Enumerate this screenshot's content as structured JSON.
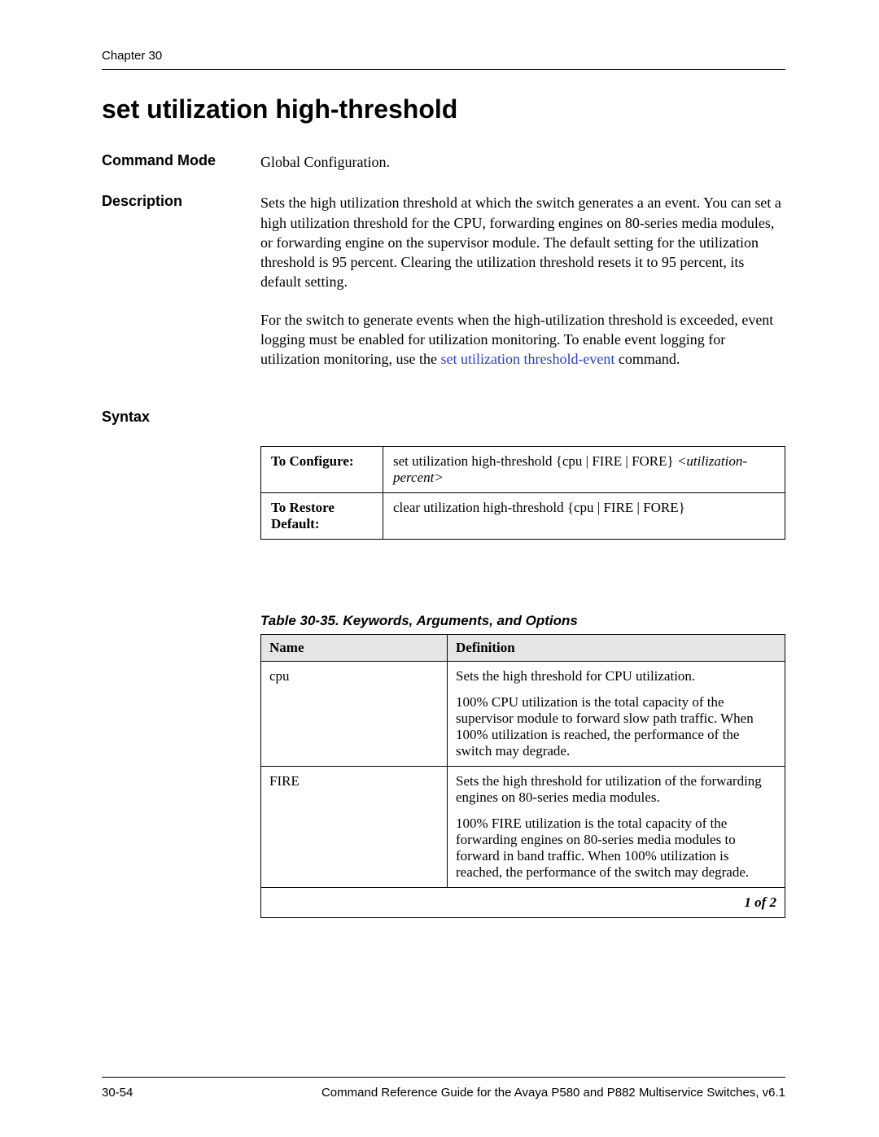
{
  "header": {
    "chapter": "Chapter 30"
  },
  "title": "set utilization high-threshold",
  "fields": {
    "command_mode": {
      "label": "Command Mode",
      "value": "Global Configuration."
    },
    "description": {
      "label": "Description",
      "para1": "Sets the high utilization threshold at which the switch generates a an event. You can set a high utilization threshold for the CPU, forwarding engines on 80-series media modules, or forwarding engine on the supervisor module. The default setting for the utilization threshold is 95 percent. Clearing the utilization threshold resets it to 95 percent, its default setting.",
      "para2_prefix": "For the switch to generate events when the high-utilization threshold is exceeded, event logging must be enabled for utilization monitoring. To enable event logging for utilization monitoring, use the ",
      "para2_link": "set utilization threshold-event",
      "para2_suffix": " command."
    },
    "syntax": {
      "label": "Syntax",
      "rows": [
        {
          "label": "To Configure:",
          "text_main": "set utilization high-threshold {cpu | FIRE | FORE} ",
          "text_italic": "<utilization-percent>"
        },
        {
          "label": "To Restore Default:",
          "text_main": "clear utilization high-threshold {cpu | FIRE | FORE}",
          "text_italic": ""
        }
      ]
    }
  },
  "keywords_table": {
    "caption": "Table 30-35. Keywords, Arguments, and Options",
    "headers": {
      "name": "Name",
      "definition": "Definition"
    },
    "rows": [
      {
        "name": "cpu",
        "def_p1": "Sets the high threshold for CPU utilization.",
        "def_p2": "100% CPU utilization is the total capacity of the supervisor module to forward slow path traffic. When 100% utilization is reached, the performance of the switch may degrade."
      },
      {
        "name": "FIRE",
        "def_p1": "Sets the high threshold for utilization of the forwarding engines on 80-series media modules.",
        "def_p2": "100% FIRE utilization is the total capacity of the forwarding engines on 80-series media modules to forward in band traffic. When 100% utilization is reached, the performance of the switch may degrade."
      }
    ],
    "pager": "1 of 2"
  },
  "footer": {
    "page_num": "30-54",
    "doc_title": "Command Reference Guide for the Avaya P580 and P882 Multiservice Switches, v6.1"
  }
}
